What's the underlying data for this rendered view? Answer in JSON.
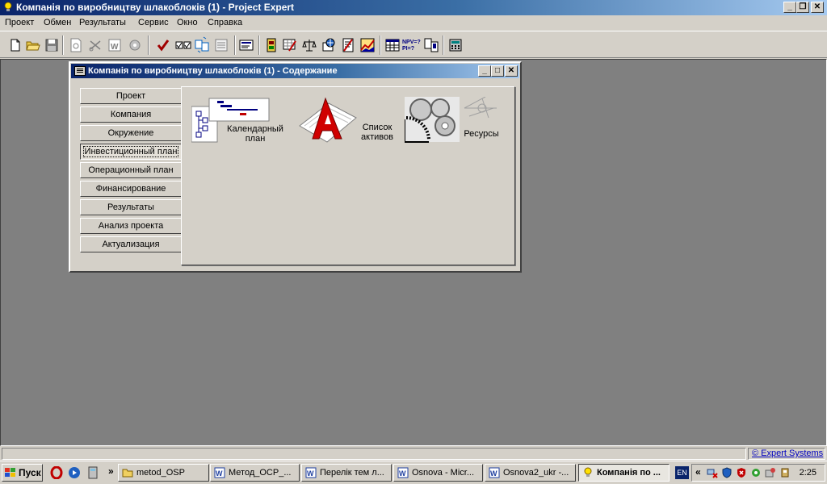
{
  "window": {
    "title": "Компанія по виробництву шлакоблоків (1) - Project Expert",
    "controls": [
      "minimize",
      "restore",
      "close"
    ]
  },
  "menu": [
    "Проект",
    "Обмен",
    "Результаты",
    "Сервис",
    "Окно",
    "Справка"
  ],
  "toolbar": {
    "icons": [
      "new-file-icon",
      "open-folder-icon",
      "save-icon",
      "print-preview-icon",
      "cut-icon",
      "word-icon",
      "settings-icon",
      "check-icon",
      "checklist-icon",
      "sync-icon",
      "notes-icon",
      "report-icon",
      "calendar-icon",
      "cashflow-icon",
      "scales-icon",
      "globe-icon",
      "document-icon",
      "chart-icon",
      "table-icon",
      "npv-pi-icon",
      "compare-icon",
      "calculator-icon"
    ],
    "npv_label": "NPV=?",
    "pi_label": "PI=?"
  },
  "child_window": {
    "title": "Компанія по виробництву шлакоблоків (1) - Содержание",
    "nav": [
      {
        "label": "Проект",
        "active": false
      },
      {
        "label": "Компания",
        "active": false
      },
      {
        "label": "Окружение",
        "active": false
      },
      {
        "label": "Инвестиционный план",
        "active": true
      },
      {
        "label": "Операционный план",
        "active": false
      },
      {
        "label": "Финансирование",
        "active": false
      },
      {
        "label": "Результаты",
        "active": false
      },
      {
        "label": "Анализ проекта",
        "active": false
      },
      {
        "label": "Актуализация",
        "active": false
      }
    ],
    "items": [
      {
        "line1": "Календарный",
        "line2": "план",
        "icon": "gantt-chart-icon"
      },
      {
        "line1": "Список",
        "line2": "активов",
        "icon": "assets-list-icon"
      },
      {
        "line1": "Ресурсы",
        "icon": "gears-icon"
      }
    ]
  },
  "statusbar": {
    "link": "© Expert Systems"
  },
  "taskbar": {
    "start": "Пуск",
    "buttons": [
      {
        "label": "metod_OSP",
        "icon": "folder-icon",
        "active": false
      },
      {
        "label": "Метод_ОСР_...",
        "icon": "word-doc-icon",
        "active": false
      },
      {
        "label": "Перелік тем л...",
        "icon": "word-doc-icon",
        "active": false
      },
      {
        "label": "Osnova - Micr...",
        "icon": "word-doc-icon",
        "active": false
      },
      {
        "label": "Osnova2_ukr -...",
        "icon": "word-doc-icon",
        "active": false
      },
      {
        "label": "Компанія по ...",
        "icon": "lightbulb-icon",
        "active": true
      }
    ],
    "tray": {
      "language": "EN",
      "chevron": "«",
      "time": "2:25"
    }
  }
}
